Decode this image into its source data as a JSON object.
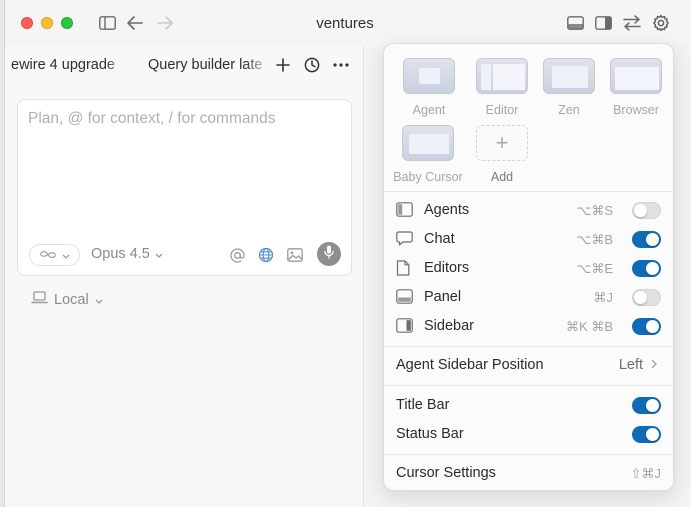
{
  "window": {
    "title": "ventures"
  },
  "tabs": [
    {
      "label": "ewire 4 upgrade"
    },
    {
      "label": "Query builder late"
    }
  ],
  "composer": {
    "placeholder": "Plan, @ for context, / for commands",
    "model": "Opus 4.5",
    "location": "Local",
    "mode_icon": "infinity-icon"
  },
  "layouts": [
    {
      "label": "Agent"
    },
    {
      "label": "Editor"
    },
    {
      "label": "Zen"
    },
    {
      "label": "Browser"
    },
    {
      "label": "Baby Cursor"
    }
  ],
  "add_layout": {
    "label": "Add"
  },
  "toggles": [
    {
      "label": "Agents",
      "shortcut": "⌥⌘S",
      "on": false,
      "icon": "agents-panel-icon"
    },
    {
      "label": "Chat",
      "shortcut": "⌥⌘B",
      "on": true,
      "icon": "chat-bubble-icon"
    },
    {
      "label": "Editors",
      "shortcut": "⌥⌘E",
      "on": true,
      "icon": "document-icon"
    },
    {
      "label": "Panel",
      "shortcut": "⌘J",
      "on": false,
      "icon": "bottom-panel-icon"
    },
    {
      "label": "Sidebar",
      "shortcut": "⌘K ⌘B",
      "on": true,
      "icon": "sidebar-icon"
    }
  ],
  "agent_sidebar_position": {
    "label": "Agent Sidebar Position",
    "value": "Left"
  },
  "bars": [
    {
      "label": "Title Bar",
      "on": true
    },
    {
      "label": "Status Bar",
      "on": true
    }
  ],
  "cursor_settings": {
    "label": "Cursor Settings",
    "shortcut": "⇧⌘J"
  },
  "colors": {
    "accent": "#0f6bb8",
    "toggle_off": "#e1e1e1"
  }
}
